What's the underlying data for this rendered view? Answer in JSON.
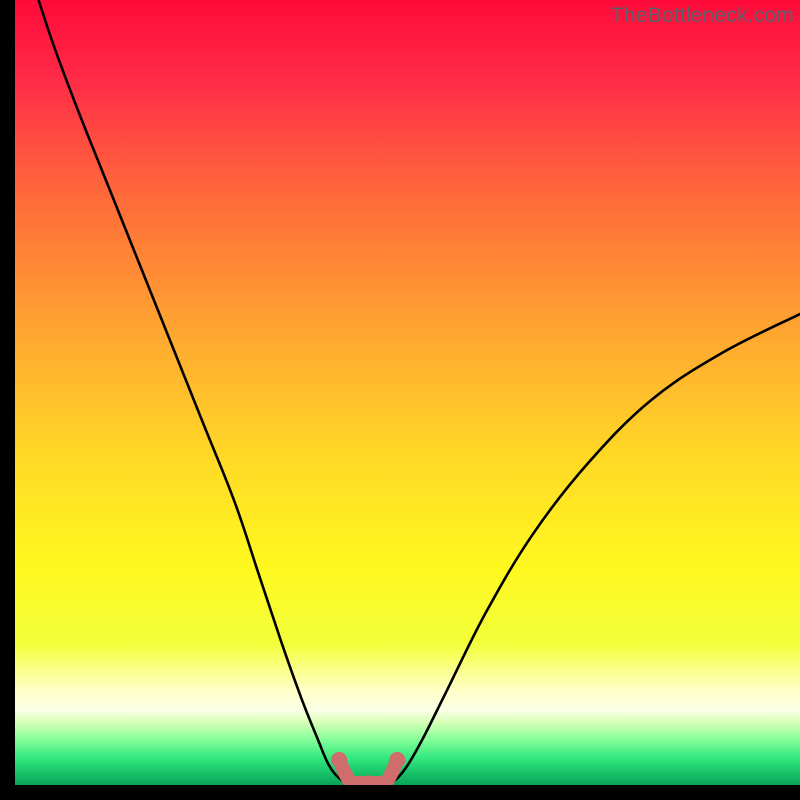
{
  "watermark": "TheBottleneck.com",
  "chart_data": {
    "type": "line",
    "title": "",
    "xlabel": "",
    "ylabel": "",
    "xlim": [
      0,
      100
    ],
    "ylim": [
      0,
      100
    ],
    "series": [
      {
        "name": "bottleneck-curve",
        "x": [
          3,
          5,
          8,
          12,
          16,
          20,
          24,
          28,
          31,
          34,
          36.5,
          38.5,
          40,
          41.5,
          43,
          45,
          47,
          48.5,
          50,
          52,
          55,
          60,
          66,
          73,
          81,
          90,
          100
        ],
        "y": [
          100,
          94,
          86,
          76,
          66,
          56,
          46,
          36,
          27,
          18,
          11,
          6,
          2.5,
          0.7,
          0,
          0,
          0,
          0.7,
          2.5,
          6,
          12,
          22,
          32,
          41,
          49,
          55,
          60
        ]
      }
    ],
    "highlight_segment": {
      "name": "optimal-range",
      "x": [
        41.3,
        42.2,
        43,
        45,
        47,
        47.8,
        48.7
      ],
      "y": [
        3.2,
        1.2,
        0.3,
        0.3,
        0.3,
        1.2,
        3.2
      ]
    },
    "gradient_stops": [
      {
        "offset": 0.0,
        "color": "#ff0a3a"
      },
      {
        "offset": 0.1,
        "color": "#ff2b47"
      },
      {
        "offset": 0.25,
        "color": "#ff6a3a"
      },
      {
        "offset": 0.42,
        "color": "#ffa531"
      },
      {
        "offset": 0.58,
        "color": "#ffd826"
      },
      {
        "offset": 0.72,
        "color": "#fff81f"
      },
      {
        "offset": 0.82,
        "color": "#f2ff3a"
      },
      {
        "offset": 0.88,
        "color": "#ffffc8"
      },
      {
        "offset": 0.905,
        "color": "#fbffe6"
      },
      {
        "offset": 0.92,
        "color": "#d6ffb8"
      },
      {
        "offset": 0.94,
        "color": "#8cff9c"
      },
      {
        "offset": 0.965,
        "color": "#35e97f"
      },
      {
        "offset": 0.985,
        "color": "#18c268"
      },
      {
        "offset": 1.0,
        "color": "#0aa257"
      }
    ],
    "curve_color": "#000000",
    "highlight_color": "#cf6d6d"
  }
}
